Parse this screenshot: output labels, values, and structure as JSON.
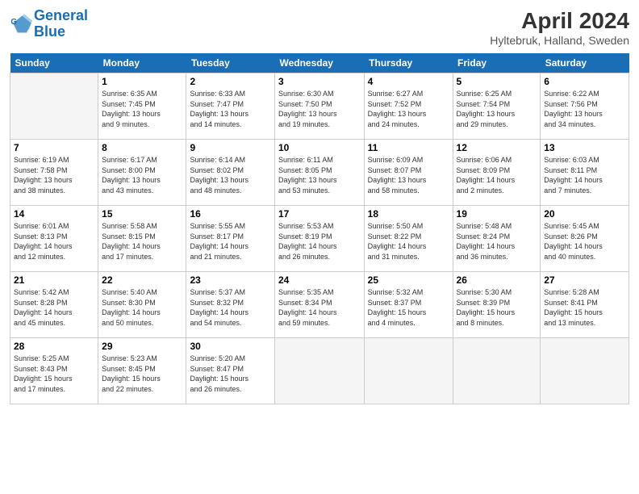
{
  "header": {
    "logo_line1": "General",
    "logo_line2": "Blue",
    "month": "April 2024",
    "location": "Hyltebruk, Halland, Sweden"
  },
  "weekdays": [
    "Sunday",
    "Monday",
    "Tuesday",
    "Wednesday",
    "Thursday",
    "Friday",
    "Saturday"
  ],
  "weeks": [
    [
      {
        "day": "",
        "info": ""
      },
      {
        "day": "1",
        "info": "Sunrise: 6:35 AM\nSunset: 7:45 PM\nDaylight: 13 hours\nand 9 minutes."
      },
      {
        "day": "2",
        "info": "Sunrise: 6:33 AM\nSunset: 7:47 PM\nDaylight: 13 hours\nand 14 minutes."
      },
      {
        "day": "3",
        "info": "Sunrise: 6:30 AM\nSunset: 7:50 PM\nDaylight: 13 hours\nand 19 minutes."
      },
      {
        "day": "4",
        "info": "Sunrise: 6:27 AM\nSunset: 7:52 PM\nDaylight: 13 hours\nand 24 minutes."
      },
      {
        "day": "5",
        "info": "Sunrise: 6:25 AM\nSunset: 7:54 PM\nDaylight: 13 hours\nand 29 minutes."
      },
      {
        "day": "6",
        "info": "Sunrise: 6:22 AM\nSunset: 7:56 PM\nDaylight: 13 hours\nand 34 minutes."
      }
    ],
    [
      {
        "day": "7",
        "info": "Sunrise: 6:19 AM\nSunset: 7:58 PM\nDaylight: 13 hours\nand 38 minutes."
      },
      {
        "day": "8",
        "info": "Sunrise: 6:17 AM\nSunset: 8:00 PM\nDaylight: 13 hours\nand 43 minutes."
      },
      {
        "day": "9",
        "info": "Sunrise: 6:14 AM\nSunset: 8:02 PM\nDaylight: 13 hours\nand 48 minutes."
      },
      {
        "day": "10",
        "info": "Sunrise: 6:11 AM\nSunset: 8:05 PM\nDaylight: 13 hours\nand 53 minutes."
      },
      {
        "day": "11",
        "info": "Sunrise: 6:09 AM\nSunset: 8:07 PM\nDaylight: 13 hours\nand 58 minutes."
      },
      {
        "day": "12",
        "info": "Sunrise: 6:06 AM\nSunset: 8:09 PM\nDaylight: 14 hours\nand 2 minutes."
      },
      {
        "day": "13",
        "info": "Sunrise: 6:03 AM\nSunset: 8:11 PM\nDaylight: 14 hours\nand 7 minutes."
      }
    ],
    [
      {
        "day": "14",
        "info": "Sunrise: 6:01 AM\nSunset: 8:13 PM\nDaylight: 14 hours\nand 12 minutes."
      },
      {
        "day": "15",
        "info": "Sunrise: 5:58 AM\nSunset: 8:15 PM\nDaylight: 14 hours\nand 17 minutes."
      },
      {
        "day": "16",
        "info": "Sunrise: 5:55 AM\nSunset: 8:17 PM\nDaylight: 14 hours\nand 21 minutes."
      },
      {
        "day": "17",
        "info": "Sunrise: 5:53 AM\nSunset: 8:19 PM\nDaylight: 14 hours\nand 26 minutes."
      },
      {
        "day": "18",
        "info": "Sunrise: 5:50 AM\nSunset: 8:22 PM\nDaylight: 14 hours\nand 31 minutes."
      },
      {
        "day": "19",
        "info": "Sunrise: 5:48 AM\nSunset: 8:24 PM\nDaylight: 14 hours\nand 36 minutes."
      },
      {
        "day": "20",
        "info": "Sunrise: 5:45 AM\nSunset: 8:26 PM\nDaylight: 14 hours\nand 40 minutes."
      }
    ],
    [
      {
        "day": "21",
        "info": "Sunrise: 5:42 AM\nSunset: 8:28 PM\nDaylight: 14 hours\nand 45 minutes."
      },
      {
        "day": "22",
        "info": "Sunrise: 5:40 AM\nSunset: 8:30 PM\nDaylight: 14 hours\nand 50 minutes."
      },
      {
        "day": "23",
        "info": "Sunrise: 5:37 AM\nSunset: 8:32 PM\nDaylight: 14 hours\nand 54 minutes."
      },
      {
        "day": "24",
        "info": "Sunrise: 5:35 AM\nSunset: 8:34 PM\nDaylight: 14 hours\nand 59 minutes."
      },
      {
        "day": "25",
        "info": "Sunrise: 5:32 AM\nSunset: 8:37 PM\nDaylight: 15 hours\nand 4 minutes."
      },
      {
        "day": "26",
        "info": "Sunrise: 5:30 AM\nSunset: 8:39 PM\nDaylight: 15 hours\nand 8 minutes."
      },
      {
        "day": "27",
        "info": "Sunrise: 5:28 AM\nSunset: 8:41 PM\nDaylight: 15 hours\nand 13 minutes."
      }
    ],
    [
      {
        "day": "28",
        "info": "Sunrise: 5:25 AM\nSunset: 8:43 PM\nDaylight: 15 hours\nand 17 minutes."
      },
      {
        "day": "29",
        "info": "Sunrise: 5:23 AM\nSunset: 8:45 PM\nDaylight: 15 hours\nand 22 minutes."
      },
      {
        "day": "30",
        "info": "Sunrise: 5:20 AM\nSunset: 8:47 PM\nDaylight: 15 hours\nand 26 minutes."
      },
      {
        "day": "",
        "info": ""
      },
      {
        "day": "",
        "info": ""
      },
      {
        "day": "",
        "info": ""
      },
      {
        "day": "",
        "info": ""
      }
    ]
  ]
}
